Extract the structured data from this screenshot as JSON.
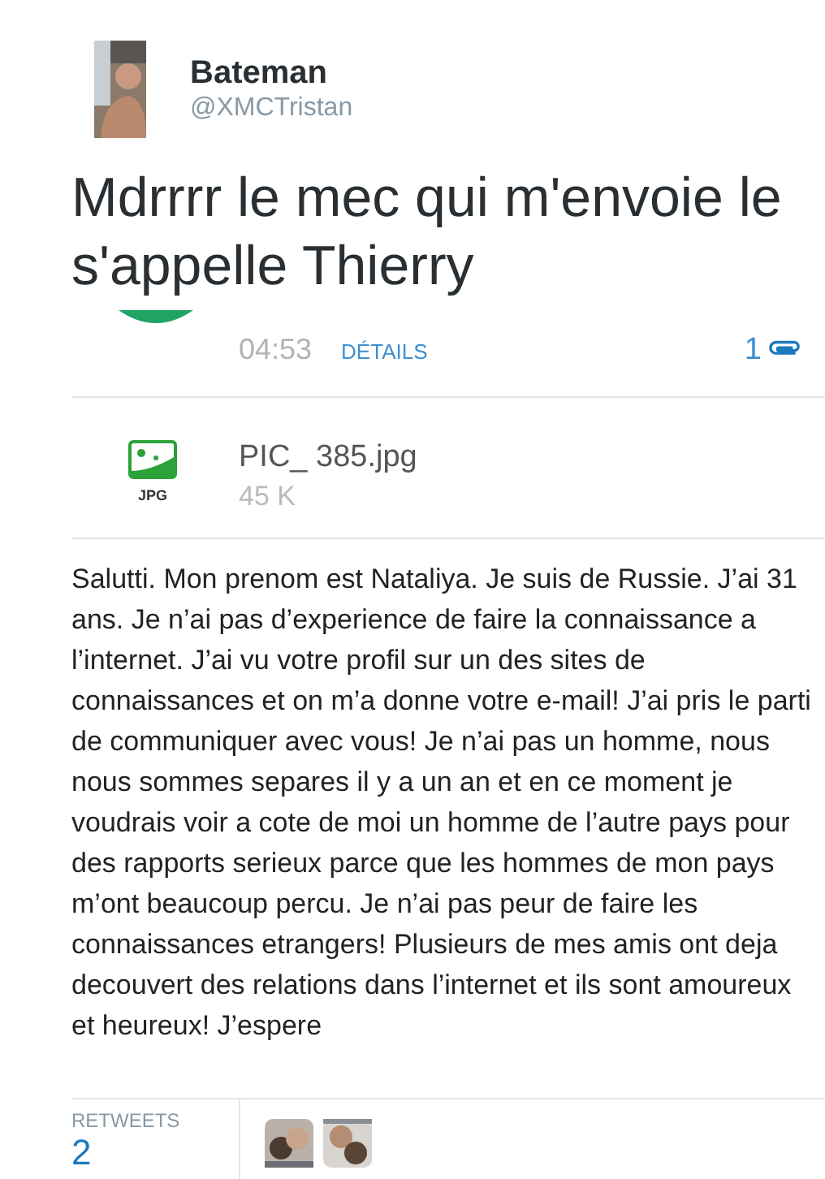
{
  "tweet": {
    "author_name": "Bateman",
    "author_handle": "@XMCTristan",
    "text": "Mdrrrr le mec qui m'envoie le s'appelle Thierry"
  },
  "embedded_screenshot": {
    "time": "04:53",
    "details_link": "DÉTAILS",
    "attachment_count": "1",
    "attachment": {
      "file_type": "JPG",
      "file_name": "PIC_ 385.jpg",
      "file_size": "45 K"
    },
    "body": "Salutti. Mon prenom est Nataliya. Je suis de Russie. J’ai 31 ans. Je n’ai pas d’experience de faire la connaissance a l’internet. J’ai vu votre profil sur un des sites de connaissances et on m’a donne votre e-mail! J’ai pris le parti de communiquer avec vous! Je n’ai pas un homme, nous nous sommes separes il y a un an et en ce moment je voudrais voir a cote de moi un homme de l’autre pays pour des rapports serieux parce que les hommes de mon pays m’ont beaucoup percu. Je n’ai pas peur de faire les connaissances etrangers! Plusieurs de mes amis ont deja decouvert des relations dans l’internet et ils sont amoureux et heureux! J’espere"
  },
  "stats": {
    "retweets_label": "RETWEETS",
    "retweets_count": "2"
  }
}
